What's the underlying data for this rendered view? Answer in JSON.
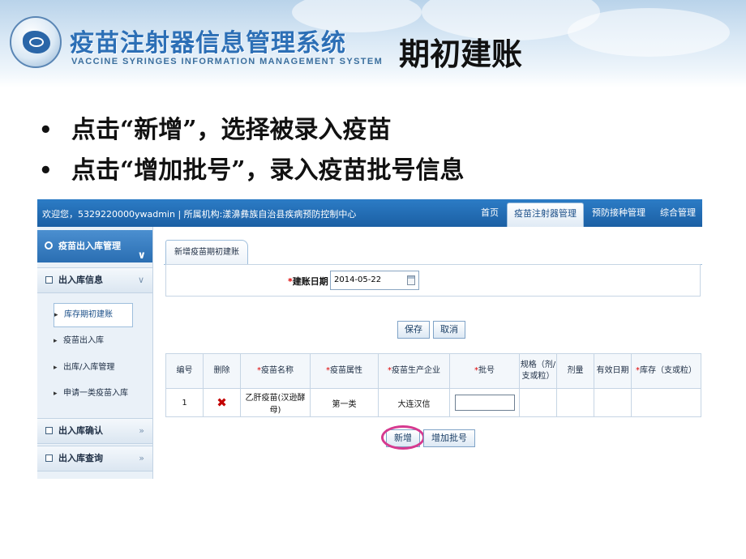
{
  "slide": {
    "system_name_cn": "疫苗注射器信息管理系统",
    "system_name_en": "VACCINE SYRINGES INFORMATION MANAGEMENT SYSTEM",
    "title": "期初建账",
    "bullets": [
      "点击“新增”，选择被录入疫苗",
      "点击“增加批号”，录入疫苗批号信息"
    ]
  },
  "app": {
    "welcome": "欢迎您，5329220000ywadmin | 所属机构:漾濞彝族自治县疾病预防控制中心",
    "nav": [
      {
        "label": "首页",
        "active": false
      },
      {
        "label": "疫苗注射器管理",
        "active": true
      },
      {
        "label": "预防接种管理",
        "active": false
      },
      {
        "label": "综合管理",
        "active": false
      }
    ],
    "sidebar": {
      "header": "疫苗出入库管理",
      "sections": [
        {
          "label": "出入库信息"
        },
        {
          "label": "出入库确认"
        },
        {
          "label": "出入库查询"
        }
      ],
      "items": [
        {
          "label": "库存期初建账",
          "active": true
        },
        {
          "label": "疫苗出入库",
          "active": false
        },
        {
          "label": "出库/入库管理",
          "active": false
        },
        {
          "label": "申请一类疫苗入库",
          "active": false
        }
      ]
    },
    "tab": "新增疫苗期初建账",
    "form": {
      "date_label": "建账日期",
      "required_mark": "*",
      "date_value": "2014-05-22"
    },
    "buttons": {
      "save": "保存",
      "cancel": "取消",
      "add": "新增",
      "add_batch": "增加批号"
    },
    "table": {
      "headers": [
        "编号",
        "删除",
        "疫苗名称",
        "疫苗属性",
        "疫苗生产企业",
        "批号",
        "规格（剂/支或粒）",
        "剂量",
        "有效日期",
        "库存（支或粒）"
      ],
      "required": [
        false,
        false,
        true,
        true,
        true,
        true,
        false,
        false,
        false,
        true
      ],
      "rows": [
        {
          "no": "1",
          "delete": "✖",
          "name": "乙肝疫苗(汉逊酵母)",
          "attr": "第一类",
          "maker": "大连汉信",
          "batch": "",
          "spec": "",
          "dose": "",
          "expiry": "",
          "stock": ""
        }
      ]
    }
  }
}
